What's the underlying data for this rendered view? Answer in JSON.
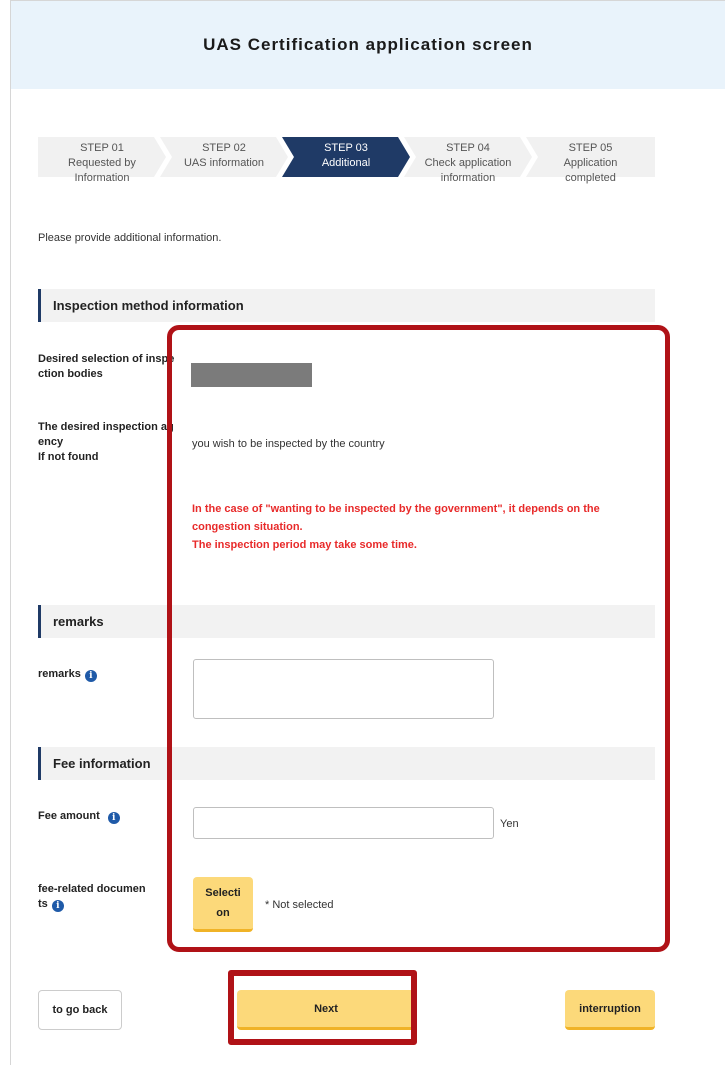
{
  "header": {
    "title": "UAS Certification application screen"
  },
  "steps": [
    {
      "num": "STEP 01",
      "line2": "Requested by",
      "line3": "Information",
      "active": false
    },
    {
      "num": "STEP 02",
      "line2": "UAS information",
      "line3": "",
      "active": false
    },
    {
      "num": "STEP 03",
      "line2": "Additional",
      "line3": "",
      "active": true
    },
    {
      "num": "STEP 04",
      "line2": "Check application",
      "line3": "information",
      "active": false
    },
    {
      "num": "STEP 05",
      "line2": "Application",
      "line3": "completed",
      "active": false
    }
  ],
  "intro": "Please provide additional information.",
  "sections": {
    "inspection": "Inspection method information",
    "remarks": "remarks",
    "fee": "Fee information"
  },
  "fields": {
    "desired_selection_l1": "Desired selection of inspe",
    "desired_selection_l2": "ction bodies",
    "agency_l1": "The desired inspection ag",
    "agency_l2": "ency",
    "agency_l3": "If not found",
    "wish_text": "you wish to be inspected by the country",
    "warning_l1": "In the case of \"wanting to be inspected by the government\", it depends on the",
    "warning_l2": "congestion situation.",
    "warning_l3": "The inspection period may take some time.",
    "remarks_label": "remarks",
    "remarks_value": "",
    "fee_amount_label": "Fee amount",
    "fee_amount_value": "",
    "yen": "Yen",
    "fee_docs_l1": "fee-related documen",
    "fee_docs_l2": "ts",
    "selection_l1": "Selecti",
    "selection_l2": "on",
    "not_selected": "* Not selected"
  },
  "buttons": {
    "back": "to go back",
    "next": "Next",
    "interruption": "interruption"
  },
  "colors": {
    "accent_navy": "#1f3a66",
    "warning_red": "#e82a2a",
    "button_yellow": "#fcd97a",
    "highlight_red": "#b01217"
  }
}
